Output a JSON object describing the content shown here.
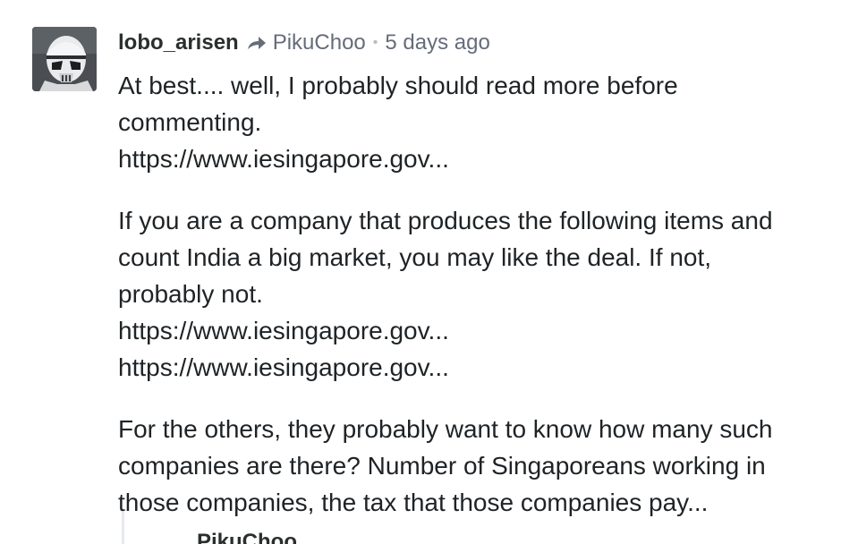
{
  "comment": {
    "author": "lobo_arisen",
    "reply_to": "PikuChoo",
    "separator": "•",
    "timestamp": "5 days ago",
    "avatar_icon": "stormtrooper-avatar-icon",
    "paragraphs": [
      {
        "lines": [
          {
            "text": "At best.... well, I probably should read more before",
            "is_link": false
          },
          {
            "text": "commenting.",
            "is_link": false
          },
          {
            "text": "https://www.iesingapore.gov...",
            "is_link": true
          }
        ]
      },
      {
        "lines": [
          {
            "text": "If you are a company that produces the following items and",
            "is_link": false
          },
          {
            "text": "count India a big market, you may like the deal. If not,",
            "is_link": false
          },
          {
            "text": "probably not.",
            "is_link": false
          },
          {
            "text": "https://www.iesingapore.gov...",
            "is_link": true
          },
          {
            "text": "https://www.iesingapore.gov...",
            "is_link": true
          }
        ]
      },
      {
        "lines": [
          {
            "text": "For the others, they probably want to know how many such",
            "is_link": false
          },
          {
            "text": "companies are there? Number of Singaporeans working in",
            "is_link": false
          },
          {
            "text": "those companies, the tax that those companies pay...",
            "is_link": false
          }
        ]
      }
    ]
  },
  "next_reply": {
    "author_partial": "PikuChoo"
  },
  "colors": {
    "text": "#1f2326",
    "muted": "#656c7a",
    "author": "#2a2e2e"
  }
}
